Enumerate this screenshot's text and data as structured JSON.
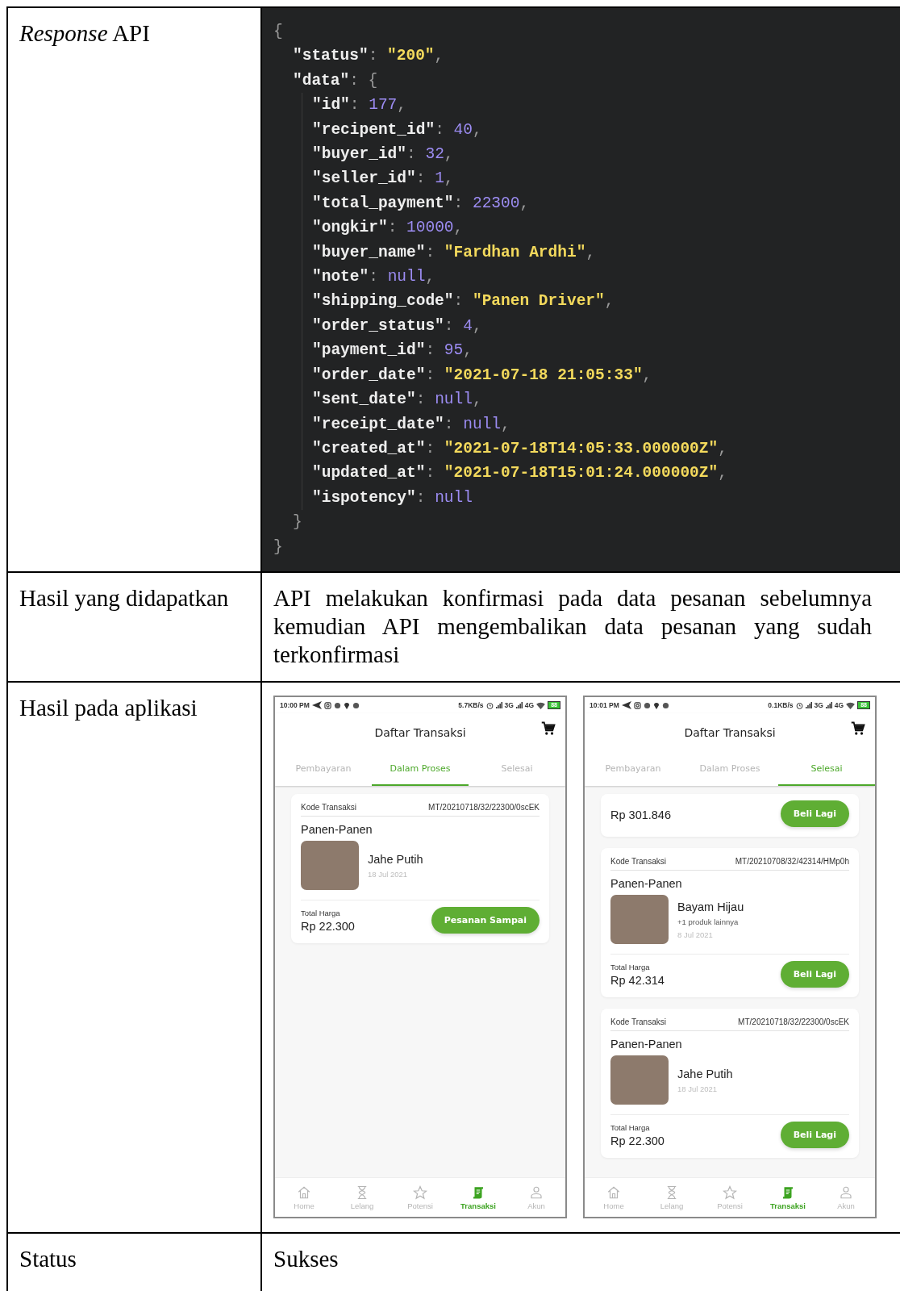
{
  "table": {
    "rows": [
      {
        "kind": "code",
        "label": "*Response* API",
        "code": {
          "lines": [
            {
              "tokens": [
                {
                  "t": "{",
                  "kind": "punct"
                }
              ],
              "children": [
                {
                  "tokens": [
                    {
                      "t": "\"status\"",
                      "kind": "key"
                    },
                    {
                      "t": ": ",
                      "kind": "punct"
                    },
                    {
                      "t": "\"200\"",
                      "kind": "string"
                    },
                    {
                      "t": ",",
                      "kind": "punct"
                    }
                  ]
                },
                {
                  "tokens": [
                    {
                      "t": "\"data\"",
                      "kind": "key"
                    },
                    {
                      "t": ": {",
                      "kind": "punct"
                    }
                  ],
                  "children": [
                    {
                      "tokens": [
                        {
                          "t": "\"id\"",
                          "kind": "key"
                        },
                        {
                          "t": ": ",
                          "kind": "punct"
                        },
                        {
                          "t": "177",
                          "kind": "number"
                        },
                        {
                          "t": ",",
                          "kind": "punct"
                        }
                      ]
                    },
                    {
                      "tokens": [
                        {
                          "t": "\"recipent_id\"",
                          "kind": "key"
                        },
                        {
                          "t": ": ",
                          "kind": "punct"
                        },
                        {
                          "t": "40",
                          "kind": "number"
                        },
                        {
                          "t": ",",
                          "kind": "punct"
                        }
                      ]
                    },
                    {
                      "tokens": [
                        {
                          "t": "\"buyer_id\"",
                          "kind": "key"
                        },
                        {
                          "t": ": ",
                          "kind": "punct"
                        },
                        {
                          "t": "32",
                          "kind": "number"
                        },
                        {
                          "t": ",",
                          "kind": "punct"
                        }
                      ]
                    },
                    {
                      "tokens": [
                        {
                          "t": "\"seller_id\"",
                          "kind": "key"
                        },
                        {
                          "t": ": ",
                          "kind": "punct"
                        },
                        {
                          "t": "1",
                          "kind": "number"
                        },
                        {
                          "t": ",",
                          "kind": "punct"
                        }
                      ]
                    },
                    {
                      "tokens": [
                        {
                          "t": "\"total_payment\"",
                          "kind": "key"
                        },
                        {
                          "t": ": ",
                          "kind": "punct"
                        },
                        {
                          "t": "22300",
                          "kind": "number"
                        },
                        {
                          "t": ",",
                          "kind": "punct"
                        }
                      ]
                    },
                    {
                      "tokens": [
                        {
                          "t": "\"ongkir\"",
                          "kind": "key"
                        },
                        {
                          "t": ": ",
                          "kind": "punct"
                        },
                        {
                          "t": "10000",
                          "kind": "number"
                        },
                        {
                          "t": ",",
                          "kind": "punct"
                        }
                      ]
                    },
                    {
                      "tokens": [
                        {
                          "t": "\"buyer_name\"",
                          "kind": "key"
                        },
                        {
                          "t": ": ",
                          "kind": "punct"
                        },
                        {
                          "t": "\"Fardhan Ardhi\"",
                          "kind": "string"
                        },
                        {
                          "t": ",",
                          "kind": "punct"
                        }
                      ]
                    },
                    {
                      "tokens": [
                        {
                          "t": "\"note\"",
                          "kind": "key"
                        },
                        {
                          "t": ": ",
                          "kind": "punct"
                        },
                        {
                          "t": "null",
                          "kind": "null"
                        },
                        {
                          "t": ",",
                          "kind": "punct"
                        }
                      ]
                    },
                    {
                      "tokens": [
                        {
                          "t": "\"shipping_code\"",
                          "kind": "key"
                        },
                        {
                          "t": ": ",
                          "kind": "punct"
                        },
                        {
                          "t": "\"Panen Driver\"",
                          "kind": "string"
                        },
                        {
                          "t": ",",
                          "kind": "punct"
                        }
                      ]
                    },
                    {
                      "tokens": [
                        {
                          "t": "\"order_status\"",
                          "kind": "key"
                        },
                        {
                          "t": ": ",
                          "kind": "punct"
                        },
                        {
                          "t": "4",
                          "kind": "number"
                        },
                        {
                          "t": ",",
                          "kind": "punct"
                        }
                      ]
                    },
                    {
                      "tokens": [
                        {
                          "t": "\"payment_id\"",
                          "kind": "key"
                        },
                        {
                          "t": ": ",
                          "kind": "punct"
                        },
                        {
                          "t": "95",
                          "kind": "number"
                        },
                        {
                          "t": ",",
                          "kind": "punct"
                        }
                      ]
                    },
                    {
                      "tokens": [
                        {
                          "t": "\"order_date\"",
                          "kind": "key"
                        },
                        {
                          "t": ": ",
                          "kind": "punct"
                        },
                        {
                          "t": "\"2021-07-18 21:05:33\"",
                          "kind": "string"
                        },
                        {
                          "t": ",",
                          "kind": "punct"
                        }
                      ]
                    },
                    {
                      "tokens": [
                        {
                          "t": "\"sent_date\"",
                          "kind": "key"
                        },
                        {
                          "t": ": ",
                          "kind": "punct"
                        },
                        {
                          "t": "null",
                          "kind": "null"
                        },
                        {
                          "t": ",",
                          "kind": "punct"
                        }
                      ]
                    },
                    {
                      "tokens": [
                        {
                          "t": "\"receipt_date\"",
                          "kind": "key"
                        },
                        {
                          "t": ": ",
                          "kind": "punct"
                        },
                        {
                          "t": "null",
                          "kind": "null"
                        },
                        {
                          "t": ",",
                          "kind": "punct"
                        }
                      ]
                    },
                    {
                      "tokens": [
                        {
                          "t": "\"created_at\"",
                          "kind": "key"
                        },
                        {
                          "t": ": ",
                          "kind": "punct"
                        },
                        {
                          "t": "\"2021-07-18T14:05:33.000000Z\"",
                          "kind": "string"
                        },
                        {
                          "t": ",",
                          "kind": "punct"
                        }
                      ]
                    },
                    {
                      "tokens": [
                        {
                          "t": "\"updated_at\"",
                          "kind": "key"
                        },
                        {
                          "t": ": ",
                          "kind": "punct"
                        },
                        {
                          "t": "\"2021-07-18T15:01:24.000000Z\"",
                          "kind": "string"
                        },
                        {
                          "t": ",",
                          "kind": "punct"
                        }
                      ]
                    },
                    {
                      "tokens": [
                        {
                          "t": "\"ispotency\"",
                          "kind": "key"
                        },
                        {
                          "t": ": ",
                          "kind": "punct"
                        },
                        {
                          "t": "null",
                          "kind": "null"
                        }
                      ]
                    }
                  ]
                },
                {
                  "tokens": [
                    {
                      "t": "}",
                      "kind": "punct"
                    }
                  ]
                }
              ]
            },
            {
              "tokens": [
                {
                  "t": "}",
                  "kind": "punct"
                }
              ]
            }
          ]
        }
      },
      {
        "kind": "text",
        "label": "Hasil yang didapatkan",
        "text": "API melakukan konfirmasi pada data pesanan sebelumnya kemudian API mengembalikan data pesanan yang sudah terkonfirmasi"
      },
      {
        "kind": "phones",
        "label": "Hasil pada aplikasi",
        "phones": [
          {
            "status_bar": {
              "time": "10:00 PM",
              "speed": "5.7KB/s",
              "networks": [
                "3G",
                "4G"
              ],
              "battery": "88"
            },
            "title": "Daftar Transaksi",
            "tabs": [
              {
                "label": "Pembayaran",
                "selected": false
              },
              {
                "label": "Dalam Proses",
                "selected": true
              },
              {
                "label": "Selesai",
                "selected": false
              }
            ],
            "cards": [
              {
                "code_label": "Kode Transaksi",
                "code": "MT/20210718/32/22300/0scEK",
                "store": "Panen-Panen",
                "product": "Jahe Putih",
                "date": "18 Jul 2021",
                "total_label": "Total Harga",
                "total": "Rp 22.300",
                "button": "Pesanan Sampai"
              }
            ],
            "nav": [
              {
                "label": "Home",
                "kind": "home",
                "selected": false
              },
              {
                "label": "Lelang",
                "kind": "hourglass",
                "selected": false
              },
              {
                "label": "Potensi",
                "kind": "star",
                "selected": false
              },
              {
                "label": "Transaksi",
                "kind": "receipt",
                "selected": true
              },
              {
                "label": "Akun",
                "kind": "person",
                "selected": false
              }
            ]
          },
          {
            "status_bar": {
              "time": "10:01 PM",
              "speed": "0.1KB/s",
              "networks": [
                "3G",
                "4G"
              ],
              "battery": "88"
            },
            "title": "Daftar Transaksi",
            "tabs": [
              {
                "label": "Pembayaran",
                "selected": false
              },
              {
                "label": "Dalam Proses",
                "selected": false
              },
              {
                "label": "Selesai",
                "selected": true
              }
            ],
            "cards": [
              {
                "total": "Rp 301.846",
                "button": "Beli Lagi"
              },
              {
                "code_label": "Kode Transaksi",
                "code": "MT/20210708/32/42314/HMp0h",
                "store": "Panen-Panen",
                "product": "Bayam Hijau",
                "extra": "+1 produk lainnya",
                "date": "8 Jul 2021",
                "total_label": "Total Harga",
                "total": "Rp 42.314",
                "button": "Beli Lagi"
              },
              {
                "code_label": "Kode Transaksi",
                "code": "MT/20210718/32/22300/0scEK",
                "store": "Panen-Panen",
                "product": "Jahe Putih",
                "date": "18 Jul 2021",
                "total_label": "Total Harga",
                "total": "Rp 22.300",
                "button": "Beli Lagi"
              }
            ],
            "nav": [
              {
                "label": "Home",
                "kind": "home",
                "selected": false
              },
              {
                "label": "Lelang",
                "kind": "hourglass",
                "selected": false
              },
              {
                "label": "Potensi",
                "kind": "star",
                "selected": false
              },
              {
                "label": "Transaksi",
                "kind": "receipt",
                "selected": true
              },
              {
                "label": "Akun",
                "kind": "person",
                "selected": false
              }
            ]
          }
        ]
      },
      {
        "kind": "text",
        "label": "Status",
        "text": "Sukses"
      }
    ]
  }
}
